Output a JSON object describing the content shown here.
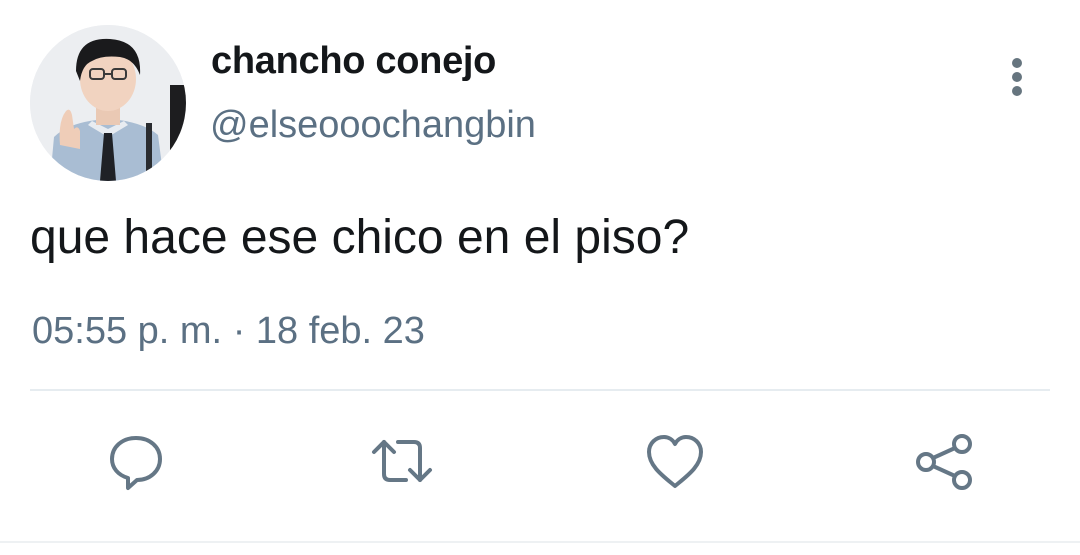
{
  "tweet": {
    "author": {
      "display_name": "chancho conejo",
      "handle": "@elseooochangbin"
    },
    "text": "que hace ese chico en el piso?",
    "time": "05:55 p. m.",
    "separator": "·",
    "date": "18 feb. 23"
  },
  "icons": {
    "more": "more-vertical-icon",
    "reply": "reply-icon",
    "retweet": "retweet-icon",
    "like": "heart-icon",
    "share": "share-icon"
  },
  "colors": {
    "text_primary": "#14171a",
    "text_secondary": "#5b7083",
    "icon": "#657786",
    "divider": "#e6ecf0"
  }
}
